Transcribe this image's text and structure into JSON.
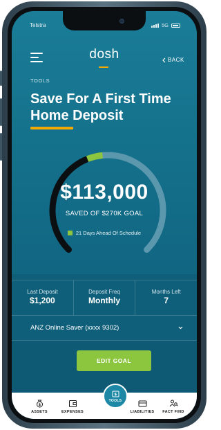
{
  "status_bar": {
    "carrier": "Telstra",
    "network": "5G"
  },
  "header": {
    "logo": "dosh",
    "back_label": "BACK"
  },
  "section_label": "TOOLS",
  "page_title": "Save For A First Time Home Deposit",
  "gauge": {
    "amount": "$113,000",
    "subtitle": "SAVED OF $270K GOAL",
    "status": "21 Days Ahead Of Schedule",
    "progress_fraction": 0.42,
    "ahead_fraction": 0.06,
    "colors": {
      "saved": "#0b0f12",
      "ahead": "#8cc63f",
      "remaining": "#5b97ad"
    }
  },
  "stats": [
    {
      "label": "Last Deposit",
      "value": "$1,200"
    },
    {
      "label": "Deposit Freq",
      "value": "Monthly"
    },
    {
      "label": "Months Left",
      "value": "7"
    }
  ],
  "account": {
    "selected": "ANZ Online Saver (xxxx 9302)"
  },
  "edit_button_label": "EDIT GOAL",
  "nav": {
    "assets": "ASSETS",
    "expenses": "EXPENSES",
    "tools": "TOOLS",
    "liabilities": "LIABILITIES",
    "fact_find": "FACT FIND"
  },
  "colors": {
    "accent": "#f2a900",
    "primary": "#14708b",
    "success": "#8cc63f"
  }
}
